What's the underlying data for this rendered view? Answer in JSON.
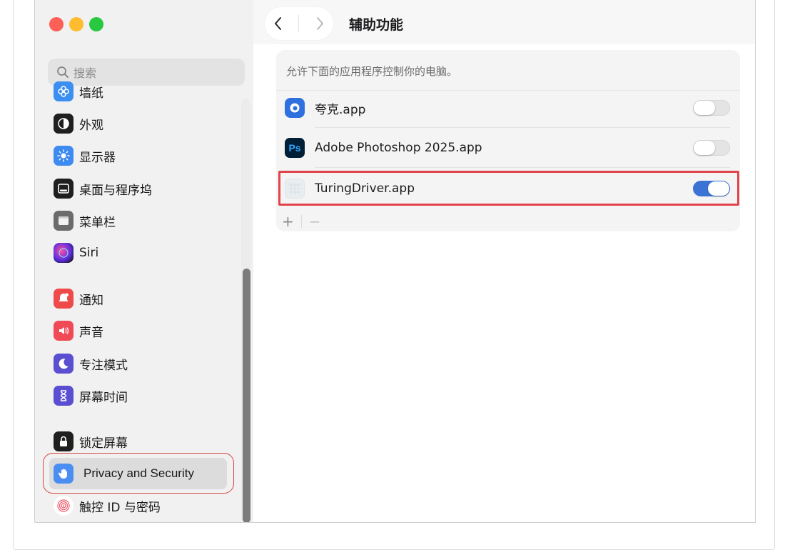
{
  "window": {
    "traffic_lights": {
      "close": "#fe5f57",
      "minimize": "#febc2e",
      "maximize": "#28c840"
    }
  },
  "sidebar": {
    "search_placeholder": "搜索",
    "items": [
      {
        "label": "墙纸",
        "icon": "wallpaper-icon"
      },
      {
        "label": "外观",
        "icon": "appearance-icon"
      },
      {
        "label": "显示器",
        "icon": "display-icon"
      },
      {
        "label": "桌面与程序坞",
        "icon": "dock-icon"
      },
      {
        "label": "菜单栏",
        "icon": "menubar-icon"
      },
      {
        "label": "Siri",
        "icon": "siri-icon"
      },
      {
        "label": "通知",
        "icon": "notifications-icon"
      },
      {
        "label": "声音",
        "icon": "sound-icon"
      },
      {
        "label": "专注模式",
        "icon": "focus-icon"
      },
      {
        "label": "屏幕时间",
        "icon": "screen-time-icon"
      },
      {
        "label": "锁定屏幕",
        "icon": "lock-screen-icon"
      },
      {
        "label": "Privacy and Security",
        "icon": "privacy-hand-icon",
        "selected": true
      },
      {
        "label": "触控 ID 与密码",
        "icon": "touch-id-icon"
      }
    ]
  },
  "main": {
    "title": "辅助功能",
    "description": "允许下面的应用程序控制你的电脑。",
    "apps": [
      {
        "name": "夸克.app",
        "icon": "quark-icon",
        "enabled": false
      },
      {
        "name": "Adobe Photoshop 2025.app",
        "icon": "photoshop-icon",
        "enabled": false
      },
      {
        "name": "TuringDriver.app",
        "icon": "turingdriver-icon",
        "enabled": true,
        "highlighted": true
      }
    ],
    "add_label": "+",
    "remove_label": "−",
    "accent_color": "#3b73d4",
    "highlight_color": "#e2444b"
  }
}
